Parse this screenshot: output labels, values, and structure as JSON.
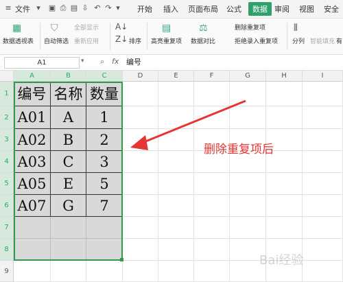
{
  "menubar": {
    "file": "文件",
    "tabs": [
      "开始",
      "插入",
      "页面布局",
      "公式",
      "数据",
      "审阅",
      "视图",
      "安全"
    ]
  },
  "ribbon": {
    "pivot": "数据透视表",
    "autofilter": "自动筛选",
    "show_all": "全部显示",
    "reapply": "重新应用",
    "sort": "排序",
    "highlight_dup": "高亮重复项",
    "compare": "数据对比",
    "remove_dup": "删除重复项",
    "reject_dup": "拒绝录入重复项",
    "split": "分列",
    "smart_fill": "智能填充",
    "more": "有"
  },
  "formula_bar": {
    "name_box": "A1",
    "fx": "fx",
    "content": "编号"
  },
  "columns": [
    "A",
    "B",
    "C",
    "D",
    "E",
    "F",
    "G",
    "H",
    "I"
  ],
  "rows": [
    "1",
    "2",
    "3",
    "4",
    "5",
    "6",
    "7",
    "8",
    "9"
  ],
  "table": {
    "header": [
      "编号",
      "名称",
      "数量"
    ],
    "rows": [
      [
        "A01",
        "A",
        "1"
      ],
      [
        "A02",
        "B",
        "2"
      ],
      [
        "A03",
        "C",
        "3"
      ],
      [
        "A05",
        "E",
        "5"
      ],
      [
        "A07",
        "G",
        "7"
      ]
    ]
  },
  "annotation": "删除重复项后",
  "watermark": "Bai经验",
  "colors": {
    "accent": "#2ea06a",
    "annotation": "#e53535",
    "selection": "#d9d9d9"
  }
}
